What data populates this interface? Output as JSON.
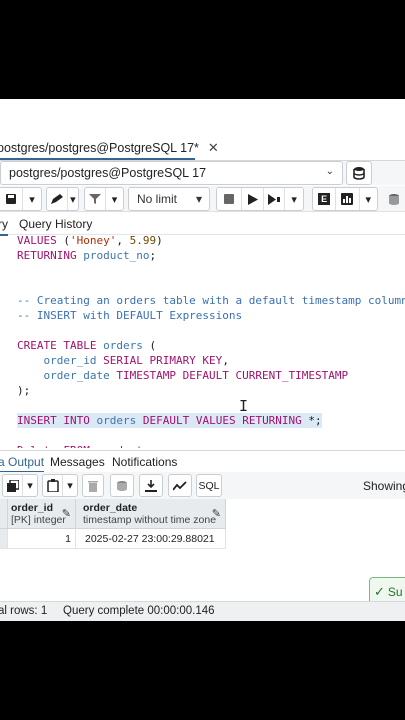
{
  "query_tab": {
    "title": "postgres/postgres@PostgreSQL 17*",
    "close_glyph": "✕"
  },
  "connection": {
    "value": "postgres/postgres@PostgreSQL 17",
    "caret": "⌄"
  },
  "toolbar": {
    "limit_value": "No limit",
    "caret": "▾",
    "explain_label": "E"
  },
  "sub_tabs": {
    "query_partial": "ry",
    "history": "Query History"
  },
  "editor": {
    "lines": [
      {
        "parts": [
          {
            "t": "VALUES ",
            "c": "kw"
          },
          {
            "t": "(",
            "c": ""
          },
          {
            "t": "'Honey'",
            "c": "str"
          },
          {
            "t": ", ",
            "c": ""
          },
          {
            "t": "5.99",
            "c": "num"
          },
          {
            "t": ")",
            "c": ""
          }
        ]
      },
      {
        "parts": [
          {
            "t": "RETURNING ",
            "c": "kw"
          },
          {
            "t": "product_no",
            "c": "fn"
          },
          {
            "t": ";",
            "c": ""
          }
        ]
      },
      {
        "parts": []
      },
      {
        "parts": []
      },
      {
        "parts": [
          {
            "t": "-- Creating an orders table with a default timestamp column",
            "c": "cm"
          }
        ]
      },
      {
        "parts": [
          {
            "t": "-- INSERT with DEFAULT Expressions",
            "c": "cm"
          }
        ]
      },
      {
        "parts": []
      },
      {
        "parts": [
          {
            "t": "CREATE TABLE ",
            "c": "kw"
          },
          {
            "t": "orders",
            "c": "fn"
          },
          {
            "t": " (",
            "c": ""
          }
        ]
      },
      {
        "parts": [
          {
            "t": "    order_id ",
            "c": "fn"
          },
          {
            "t": "SERIAL PRIMARY KEY",
            "c": "kw"
          },
          {
            "t": ",",
            "c": ""
          }
        ]
      },
      {
        "parts": [
          {
            "t": "    order_date ",
            "c": "fn"
          },
          {
            "t": "TIMESTAMP DEFAULT CURRENT_TIMESTAMP",
            "c": "kw"
          }
        ]
      },
      {
        "parts": [
          {
            "t": ");",
            "c": ""
          }
        ]
      },
      {
        "parts": []
      },
      {
        "parts": [
          {
            "t": "INSERT INTO ",
            "c": "kw"
          },
          {
            "t": "orders",
            "c": "fn"
          },
          {
            "t": " DEFAULT VALUES RETURNING ",
            "c": "kw"
          },
          {
            "t": "*",
            "c": ""
          },
          {
            "t": ";",
            "c": ""
          }
        ],
        "highlight": true
      },
      {
        "parts": []
      },
      {
        "parts": [
          {
            "t": "Delete FROM products",
            "c": "kw"
          }
        ]
      }
    ]
  },
  "results_tabs": {
    "data_output_partial": "a Output",
    "messages": "Messages",
    "notifications": "Notifications"
  },
  "result_toolbar": {
    "sql_label": "SQL",
    "showing_partial": "Showing"
  },
  "grid": {
    "columns": [
      {
        "name": "order_id",
        "type": "[PK] integer"
      },
      {
        "name": "order_date",
        "type": "timestamp without time zone"
      }
    ],
    "rows": [
      {
        "row_num": "1",
        "order_id": "1",
        "order_date": "2025-02-27 23:00:29.88021"
      }
    ]
  },
  "toast": {
    "text": "Su"
  },
  "status": {
    "rows": "al rows: 1",
    "query": "Query complete 00:00:00.146"
  },
  "colors": {
    "accent": "#326690",
    "keyword": "#a0126e",
    "comment": "#3a70b3",
    "highlight": "#dbe8f5"
  },
  "cursor_glyph": "I"
}
